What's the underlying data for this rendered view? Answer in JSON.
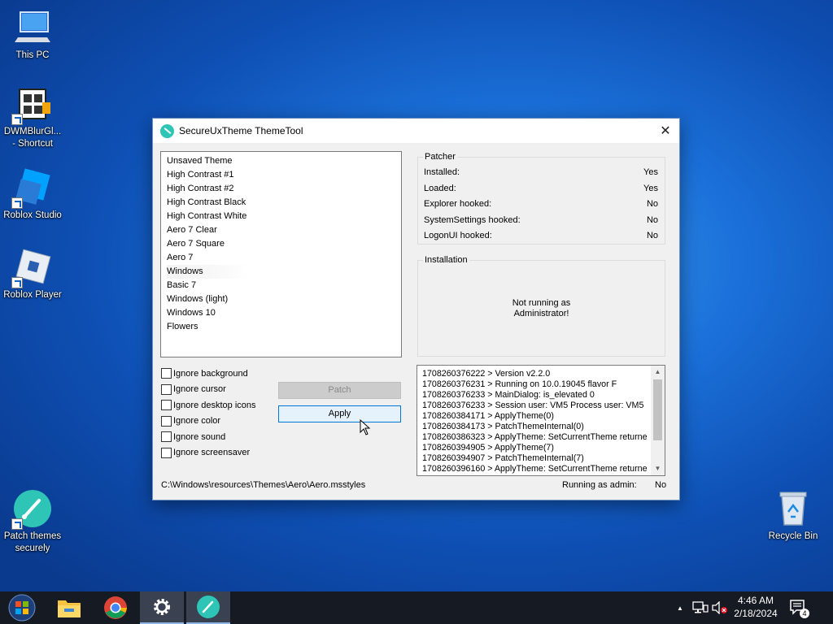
{
  "desktop": {
    "icons": [
      {
        "label": "This PC"
      },
      {
        "label": "DWMBlurGl...\n- Shortcut"
      },
      {
        "label": "Roblox Studio"
      },
      {
        "label": "Roblox Player"
      },
      {
        "label": "Patch themes\nsecurely"
      },
      {
        "label": "Recycle Bin"
      }
    ]
  },
  "window": {
    "title": "SecureUxTheme ThemeTool",
    "close_glyph": "✕",
    "themes": [
      "Unsaved Theme",
      "High Contrast #1",
      "High Contrast #2",
      "High Contrast Black",
      "High Contrast White",
      "Aero 7 Clear",
      "Aero 7 Square",
      "Aero 7",
      "Windows",
      "Basic 7",
      "Windows (light)",
      "Windows 10",
      "Flowers"
    ],
    "patcher": {
      "title": "Patcher",
      "rows": [
        {
          "label": "Installed:",
          "value": "Yes"
        },
        {
          "label": "Loaded:",
          "value": "Yes"
        },
        {
          "label": "Explorer hooked:",
          "value": "No"
        },
        {
          "label": "SystemSettings hooked:",
          "value": "No"
        },
        {
          "label": "LogonUI hooked:",
          "value": "No"
        }
      ]
    },
    "installation": {
      "title": "Installation",
      "message_line1": "Not running as",
      "message_line2": "Administrator!"
    },
    "checkboxes": [
      "Ignore background",
      "Ignore cursor",
      "Ignore desktop icons",
      "Ignore color",
      "Ignore sound",
      "Ignore screensaver"
    ],
    "patch_label": "Patch",
    "apply_label": "Apply",
    "log": [
      "1708260376222 > Version v2.2.0",
      "1708260376231 > Running on 10.0.19045 flavor F",
      "1708260376233 > MainDialog: is_elevated 0",
      "1708260376233 > Session user: VM5 Process user: VM5",
      "1708260384171 > ApplyTheme(0)",
      "1708260384173 > PatchThemeInternal(0)",
      "1708260386323 > ApplyTheme: SetCurrentTheme returne",
      "1708260394905 > ApplyTheme(7)",
      "1708260394907 > PatchThemeInternal(7)",
      "1708260396160 > ApplyTheme: SetCurrentTheme returne"
    ],
    "path": "C:\\Windows\\resources\\Themes\\Aero\\Aero.msstyles",
    "admin_label": "Running as admin:",
    "admin_value": "No"
  },
  "taskbar": {
    "apps": [
      "start-orb",
      "file-explorer",
      "chrome",
      "settings",
      "patch-themes-tool"
    ],
    "tray_chevron": "▲",
    "time": "4:46 AM",
    "date": "2/18/2024",
    "notification_count": "4"
  }
}
